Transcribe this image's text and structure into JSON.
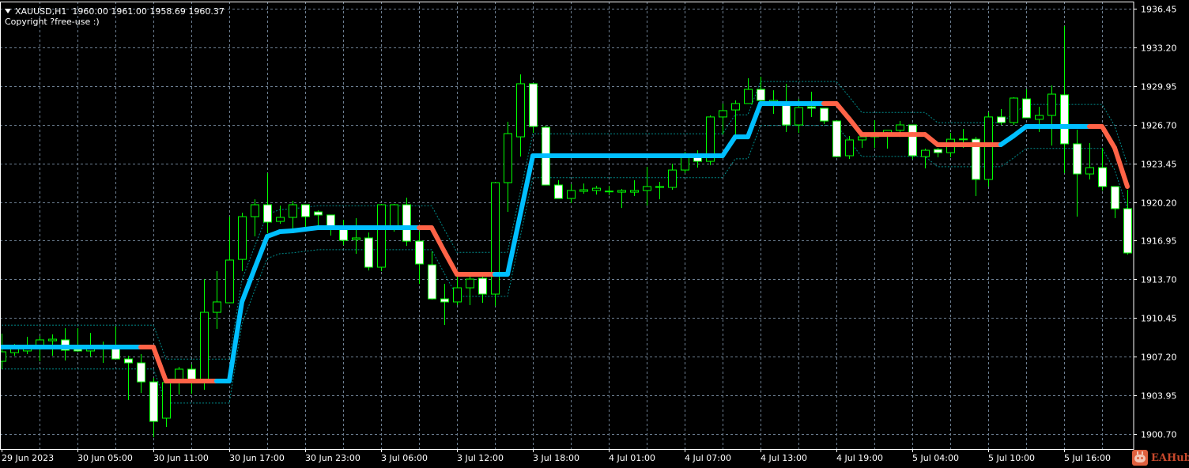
{
  "header": {
    "symbol_line": "XAUUSD,H1  1960.00 1961.00 1958.69 1960.37",
    "copyright": "Copyright ?free-use :)"
  },
  "logo": {
    "text": "EAHub"
  },
  "colors": {
    "background": "#000000",
    "grid": "#6d7f92",
    "candle_outline": "#00ff00",
    "bear_fill": "#ffffff",
    "bull_fill": "#000000",
    "trend_up": "#00bfff",
    "trend_down": "#ff6347",
    "band": "#008b8b",
    "axis": "#ffffff"
  },
  "chart_data": {
    "type": "candlestick",
    "title": "XAUUSD,H1",
    "ylim": [
      1900.7,
      1936.45
    ],
    "y_ticks": [
      "1936.45",
      "1933.20",
      "1929.95",
      "1926.70",
      "1923.45",
      "1920.20",
      "1916.95",
      "1913.70",
      "1910.45",
      "1907.20",
      "1903.95",
      "1900.70"
    ],
    "x_labels": [
      {
        "index": 0,
        "label": "29 Jun 2023"
      },
      {
        "index": 6,
        "label": "30 Jun 05:00"
      },
      {
        "index": 12,
        "label": "30 Jun 11:00"
      },
      {
        "index": 18,
        "label": "30 Jun 17:00"
      },
      {
        "index": 24,
        "label": "30 Jun 23:00"
      },
      {
        "index": 30,
        "label": "3 Jul 06:00"
      },
      {
        "index": 36,
        "label": "3 Jul 12:00"
      },
      {
        "index": 42,
        "label": "3 Jul 18:00"
      },
      {
        "index": 48,
        "label": "4 Jul 01:00"
      },
      {
        "index": 54,
        "label": "4 Jul 07:00"
      },
      {
        "index": 60,
        "label": "4 Jul 13:00"
      },
      {
        "index": 66,
        "label": "4 Jul 19:00"
      },
      {
        "index": 72,
        "label": "5 Jul 04:00"
      },
      {
        "index": 78,
        "label": "5 Jul 10:00"
      },
      {
        "index": 84,
        "label": "5 Jul 16:00"
      }
    ],
    "grid": true,
    "ohlc_columns": [
      "open",
      "high",
      "low",
      "close"
    ],
    "candles": [
      [
        1906.81,
        1909.14,
        1906.15,
        1907.61
      ],
      [
        1907.54,
        1908.27,
        1907.28,
        1908.01
      ],
      [
        1907.68,
        1908.87,
        1907.41,
        1908.14
      ],
      [
        1908.01,
        1908.94,
        1906.81,
        1908.61
      ],
      [
        1908.54,
        1909.07,
        1907.28,
        1908.67
      ],
      [
        1908.61,
        1909.6,
        1906.88,
        1907.74
      ],
      [
        1907.81,
        1909.6,
        1907.61,
        1907.68
      ],
      [
        1907.68,
        1909.2,
        1907.21,
        1908.01
      ],
      [
        1907.94,
        1908.47,
        1906.68,
        1908.01
      ],
      [
        1907.94,
        1909.74,
        1907.01,
        1907.01
      ],
      [
        1907.01,
        1907.28,
        1903.56,
        1906.68
      ],
      [
        1906.68,
        1907.41,
        1904.15,
        1905.08
      ],
      [
        1905.08,
        1905.42,
        1900.43,
        1901.76
      ],
      [
        1902.03,
        1905.15,
        1901.3,
        1905.02
      ],
      [
        1905.02,
        1906.35,
        1904.02,
        1906.15
      ],
      [
        1906.15,
        1906.55,
        1904.09,
        1905.15
      ],
      [
        1905.15,
        1913.72,
        1904.42,
        1910.93
      ],
      [
        1910.93,
        1914.39,
        1909.54,
        1911.8
      ],
      [
        1911.73,
        1918.97,
        1911.73,
        1915.32
      ],
      [
        1915.38,
        1919.3,
        1914.39,
        1918.97
      ],
      [
        1918.97,
        1920.43,
        1917.31,
        1919.97
      ],
      [
        1919.97,
        1922.63,
        1917.58,
        1918.51
      ],
      [
        1918.57,
        1919.9,
        1918.37,
        1918.91
      ],
      [
        1918.91,
        1920.3,
        1917.91,
        1919.97
      ],
      [
        1919.97,
        1919.97,
        1917.91,
        1918.97
      ],
      [
        1919.37,
        1919.5,
        1918.24,
        1919.11
      ],
      [
        1919.11,
        1919.11,
        1917.38,
        1918.18
      ],
      [
        1917.91,
        1918.71,
        1916.58,
        1916.98
      ],
      [
        1917.05,
        1918.84,
        1915.85,
        1917.18
      ],
      [
        1917.18,
        1917.64,
        1914.45,
        1914.72
      ],
      [
        1914.72,
        1920.04,
        1914.39,
        1919.97
      ],
      [
        1918.04,
        1920.04,
        1917.71,
        1919.97
      ],
      [
        1919.97,
        1920.57,
        1916.51,
        1916.91
      ],
      [
        1916.91,
        1917.71,
        1913.32,
        1914.99
      ],
      [
        1914.92,
        1916.05,
        1912.0,
        1912.06
      ],
      [
        1912.06,
        1913.32,
        1909.87,
        1911.8
      ],
      [
        1911.8,
        1913.99,
        1911.53,
        1912.99
      ],
      [
        1912.99,
        1913.92,
        1911.53,
        1913.72
      ],
      [
        1913.79,
        1913.92,
        1911.73,
        1912.46
      ],
      [
        1912.46,
        1921.83,
        1911.46,
        1921.83
      ],
      [
        1921.83,
        1926.95,
        1919.37,
        1925.95
      ],
      [
        1925.68,
        1930.93,
        1924.02,
        1930.14
      ],
      [
        1930.14,
        1930.2,
        1926.02,
        1926.55
      ],
      [
        1926.48,
        1926.61,
        1921.63,
        1921.63
      ],
      [
        1921.63,
        1922.03,
        1920.5,
        1920.5
      ],
      [
        1920.5,
        1921.7,
        1920.1,
        1921.17
      ],
      [
        1921.1,
        1921.76,
        1920.9,
        1921.23
      ],
      [
        1921.17,
        1921.56,
        1920.83,
        1921.36
      ],
      [
        1921.1,
        1921.56,
        1920.77,
        1921.12
      ],
      [
        1921.03,
        1921.3,
        1919.7,
        1921.17
      ],
      [
        1921.03,
        1922.03,
        1920.7,
        1921.17
      ],
      [
        1921.17,
        1923.16,
        1919.9,
        1921.5
      ],
      [
        1921.43,
        1921.9,
        1920.43,
        1921.5
      ],
      [
        1921.43,
        1923.42,
        1921.23,
        1922.89
      ],
      [
        1922.89,
        1924.42,
        1922.63,
        1924.02
      ],
      [
        1924.02,
        1924.55,
        1923.09,
        1923.62
      ],
      [
        1923.62,
        1927.48,
        1923.29,
        1927.35
      ],
      [
        1927.35,
        1928.48,
        1925.88,
        1927.88
      ],
      [
        1927.94,
        1928.74,
        1925.88,
        1928.48
      ],
      [
        1928.48,
        1930.6,
        1928.48,
        1929.67
      ],
      [
        1929.67,
        1930.73,
        1928.54,
        1928.74
      ],
      [
        1928.61,
        1929.6,
        1927.61,
        1928.74
      ],
      [
        1928.34,
        1930.14,
        1926.08,
        1926.68
      ],
      [
        1926.68,
        1928.87,
        1926.02,
        1928.14
      ],
      [
        1928.21,
        1929.47,
        1927.35,
        1928.08
      ],
      [
        1928.08,
        1928.1,
        1926.75,
        1927.01
      ],
      [
        1927.01,
        1927.08,
        1923.96,
        1924.02
      ],
      [
        1924.09,
        1925.75,
        1923.82,
        1925.42
      ],
      [
        1925.42,
        1925.68,
        1924.75,
        1925.68
      ],
      [
        1925.68,
        1927.08,
        1924.75,
        1925.75
      ],
      [
        1925.88,
        1926.22,
        1924.69,
        1926.22
      ],
      [
        1926.22,
        1927.01,
        1925.68,
        1926.68
      ],
      [
        1926.68,
        1926.7,
        1923.82,
        1924.09
      ],
      [
        1924.02,
        1924.69,
        1923.03,
        1924.55
      ],
      [
        1924.62,
        1924.75,
        1923.96,
        1924.35
      ],
      [
        1924.35,
        1926.02,
        1923.96,
        1925.48
      ],
      [
        1925.48,
        1926.35,
        1924.75,
        1925.5
      ],
      [
        1925.48,
        1925.68,
        1920.7,
        1922.1
      ],
      [
        1922.1,
        1927.74,
        1921.5,
        1927.35
      ],
      [
        1927.35,
        1928.01,
        1926.68,
        1926.88
      ],
      [
        1926.88,
        1929.01,
        1926.68,
        1928.94
      ],
      [
        1928.87,
        1929.67,
        1927.28,
        1927.28
      ],
      [
        1927.15,
        1928.21,
        1926.08,
        1927.48
      ],
      [
        1927.48,
        1930.0,
        1924.95,
        1929.27
      ],
      [
        1929.21,
        1934.99,
        1922.63,
        1925.09
      ],
      [
        1925.09,
        1926.28,
        1918.97,
        1922.56
      ],
      [
        1922.56,
        1925.15,
        1922.1,
        1923.09
      ],
      [
        1923.09,
        1924.75,
        1921.17,
        1921.5
      ],
      [
        1921.5,
        1921.5,
        1918.84,
        1919.64
      ],
      [
        1919.64,
        1921.23,
        1915.78,
        1915.92
      ]
    ],
    "indicator": {
      "values": [
        1908.01,
        1908.01,
        1908.01,
        1908.01,
        1908.01,
        1908.01,
        1908.01,
        1908.01,
        1908.01,
        1908.01,
        1908.01,
        1908.01,
        1908.01,
        1905.15,
        1905.15,
        1905.15,
        1905.15,
        1905.15,
        1905.15,
        1911.8,
        1914.59,
        1917.31,
        1917.71,
        1917.78,
        1917.91,
        1918.04,
        1918.04,
        1918.04,
        1918.04,
        1918.04,
        1918.04,
        1918.04,
        1918.04,
        1918.04,
        1918.04,
        1916.05,
        1914.12,
        1914.12,
        1914.12,
        1914.12,
        1914.12,
        1919.11,
        1924.09,
        1924.09,
        1924.09,
        1924.09,
        1924.09,
        1924.09,
        1924.09,
        1924.09,
        1924.09,
        1924.09,
        1924.09,
        1924.09,
        1924.09,
        1924.09,
        1924.09,
        1924.09,
        1925.68,
        1925.68,
        1928.48,
        1928.48,
        1928.48,
        1928.48,
        1928.48,
        1928.48,
        1928.48,
        1927.21,
        1925.88,
        1925.88,
        1925.88,
        1925.88,
        1925.88,
        1925.88,
        1925.02,
        1925.02,
        1925.02,
        1925.02,
        1925.02,
        1925.02,
        1925.75,
        1926.55,
        1926.55,
        1926.55,
        1926.55,
        1926.55,
        1926.55,
        1926.55,
        1924.75,
        1921.5
      ],
      "trend": "uuuuuuuuuuuddddddUUUUUUUUUUUUUUUUddddddUUUUUUUUUUUUUUUUUUUUUUUUUUddddddddddddddUUUUUUUdddd",
      "band_offset": 1.85
    }
  }
}
